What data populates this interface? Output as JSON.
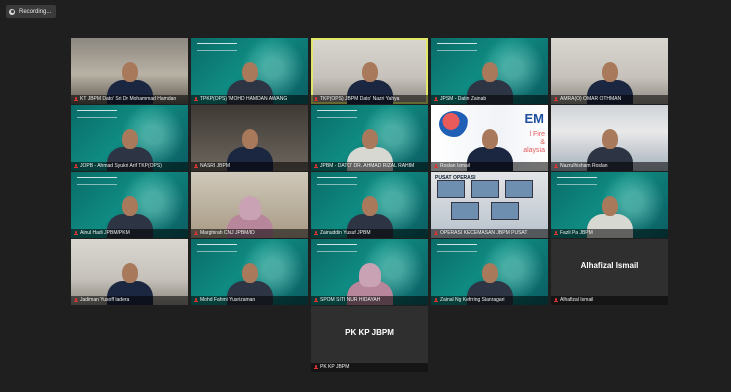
{
  "recording": {
    "label": "Recording..."
  },
  "participants": [
    {
      "name": "KT JBPM Dato' Sri Dr Mohammad Hamdan",
      "bg": "bg-office",
      "figure": "uniform"
    },
    {
      "name": "TPKP(OPS) 'MOHD HAMDAN AWANG",
      "bg": "bg-teal",
      "figure": "suit"
    },
    {
      "name": "TKP(OPS) JBPM Dato' Nazri Yahya",
      "bg": "bg-room",
      "figure": "uniform",
      "speaker": true
    },
    {
      "name": "JPSM - Datin Zainab",
      "bg": "bg-teal",
      "figure": "suit"
    },
    {
      "name": "AMRA(O) OMAR OTHMAN",
      "bg": "bg-room",
      "figure": "uniform"
    },
    {
      "name": "JOPB - Ahmad Syukri Arif TKP(OPS)",
      "bg": "bg-teal",
      "figure": "suit"
    },
    {
      "name": "NASRI JBPM",
      "bg": "bg-dark",
      "figure": "uniform"
    },
    {
      "name": "JPBM - DATO' DR. AHMAD RIZAL RAHIM",
      "bg": "bg-teal",
      "figure": "light"
    },
    {
      "name": "Roslan Ismail",
      "bg": "bg-brand",
      "figure": "uniform",
      "brand": true
    },
    {
      "name": "Nazrulhisham Roslan",
      "bg": "bg-red",
      "figure": "suit"
    },
    {
      "name": "Ainul Hadi JPBM/PKM",
      "bg": "bg-teal",
      "figure": "suit"
    },
    {
      "name": "Marghirah CNJ JPBM/ID",
      "bg": "bg-mosque",
      "figure": "hijab"
    },
    {
      "name": "Zainuddin Yusuf JPBM",
      "bg": "bg-teal",
      "figure": "suit"
    },
    {
      "name": "OPERASI KECEMASAN JBPM PUSAT",
      "bg": "bg-monitors",
      "figure": "none",
      "monitors": true
    },
    {
      "name": "Fazli Pa JBPM",
      "bg": "bg-teal",
      "figure": "light"
    },
    {
      "name": "Jadiman Yusoff ladera",
      "bg": "bg-room",
      "figure": "uniform"
    },
    {
      "name": "Mohd Fahmi Yusrizaman",
      "bg": "bg-teal",
      "figure": "suit"
    },
    {
      "name": "SPOM SITI NUR HIDAYAH",
      "bg": "bg-teal",
      "figure": "hijab"
    },
    {
      "name": "Zainal Ng Kefrring Sianragari",
      "bg": "bg-teal",
      "figure": "suit"
    },
    {
      "name": "Alhafizal Ismail",
      "bg": "bg-gray",
      "figure": "none",
      "center": "Alhafizal Ismail"
    },
    {
      "name": "PK KP JBPM",
      "bg": "bg-gray",
      "figure": "none",
      "center": "PK KP JBPM",
      "col": 3
    }
  ],
  "brand_tile": {
    "big": "EM",
    "line1": "l Fire",
    "line2": "&",
    "line3": "alaysia"
  },
  "monitor_text": "PUSAT OPERASI",
  "colors": {
    "teal": "#0f8b82",
    "speaker_outline": "#e2e86a",
    "mic": "#dd3333"
  }
}
